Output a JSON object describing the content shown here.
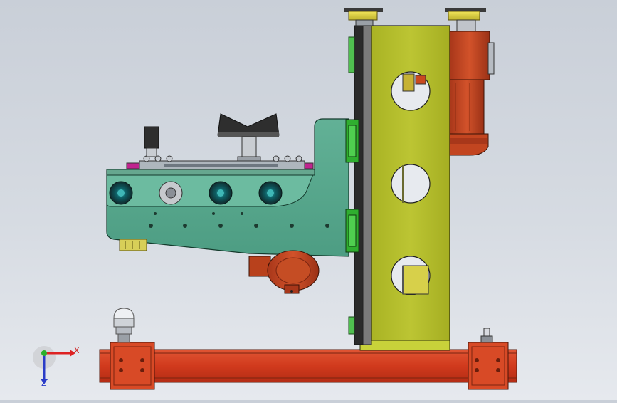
{
  "view": {
    "triad": {
      "x_label": "X",
      "z_label": "Z"
    }
  },
  "colors": {
    "background_top": "#c9cfd8",
    "base_beam": "#d43a1e",
    "column": "#b8c22e",
    "arm": "#55a88e",
    "motor": "#c9491f",
    "gear_yellow": "#e0d640",
    "rail_green": "#2fae2f",
    "magenta": "#c0248f"
  },
  "icons": [
    "coordinate-triad-icon"
  ]
}
